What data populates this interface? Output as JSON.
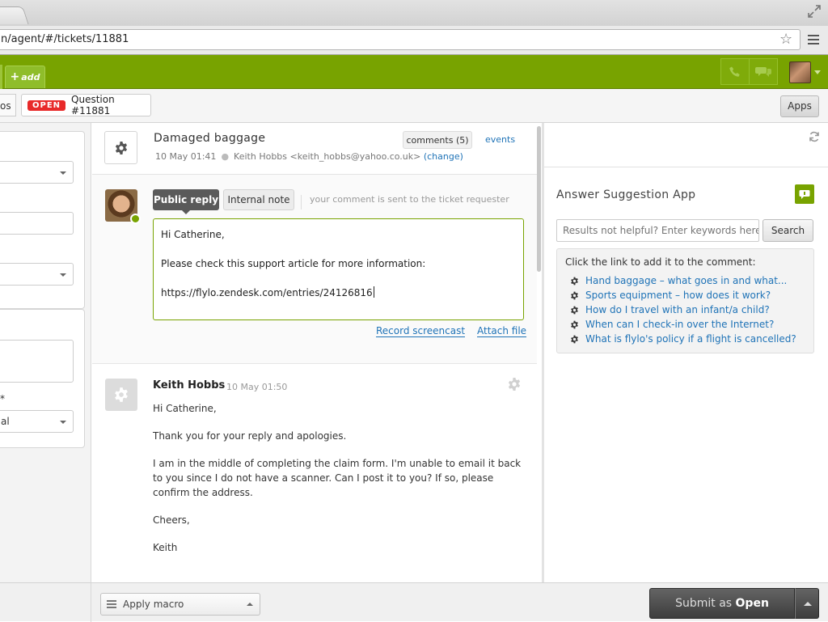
{
  "browser": {
    "url": "n/agent/#/tickets/11881",
    "icons": {
      "bookmark": "star-icon",
      "menu": "hamburger-icon",
      "window": "expand-icon"
    }
  },
  "topbar": {
    "add_tab_label": "add",
    "accent_color": "#78a300",
    "icons": [
      "phone-icon",
      "chat-icon"
    ]
  },
  "tabs": {
    "prev_tab_fragment": "os",
    "current": {
      "status_badge": "OPEN",
      "label": "Question #11881"
    },
    "apps_button": "Apps"
  },
  "left_panel": {
    "field_fragments": [
      "*",
      "al"
    ]
  },
  "ticket": {
    "subject": "Damaged baggage",
    "date": "10 May 01:41",
    "requester": "Keith Hobbs <keith_hobbs@yahoo.co.uk>",
    "change_link": "(change)",
    "view_tabs": {
      "comments": "comments (5)",
      "events": "events"
    }
  },
  "reply": {
    "public_label": "Public reply",
    "internal_label": "Internal note",
    "hint": "your comment is sent to the ticket requester",
    "body_lines": [
      "Hi Catherine,",
      "Please check this support article for more information:",
      "https://flylo.zendesk.com/entries/24126816"
    ],
    "record_screencast": "Record screencast",
    "attach_file": "Attach file"
  },
  "comments": [
    {
      "author": "Keith Hobbs",
      "date": "10 May 01:50",
      "paragraphs": [
        "Hi Catherine,",
        "Thank you for your reply and apologies.",
        "I am in the middle of completing the claim form. I'm unable to email it back to you since I do not have a scanner. Can I post it to you? If so, please confirm the address.",
        "Cheers,",
        "Keith"
      ]
    }
  ],
  "app": {
    "title": "Answer Suggestion App",
    "search_placeholder": "Results not helpful? Enter keywords here.",
    "search_button": "Search",
    "instructions": "Click the link to add it to the comment:",
    "suggestions": [
      "Hand baggage – what goes in and what...",
      "Sports equipment – how does it work?",
      "How do I travel with an infant/a child?",
      "When can I check-in over the Internet?",
      "What is flylo's policy if a flight is cancelled?"
    ]
  },
  "bottom": {
    "macro_label": "Apply macro",
    "submit_prefix": "Submit as",
    "submit_status": "Open"
  }
}
